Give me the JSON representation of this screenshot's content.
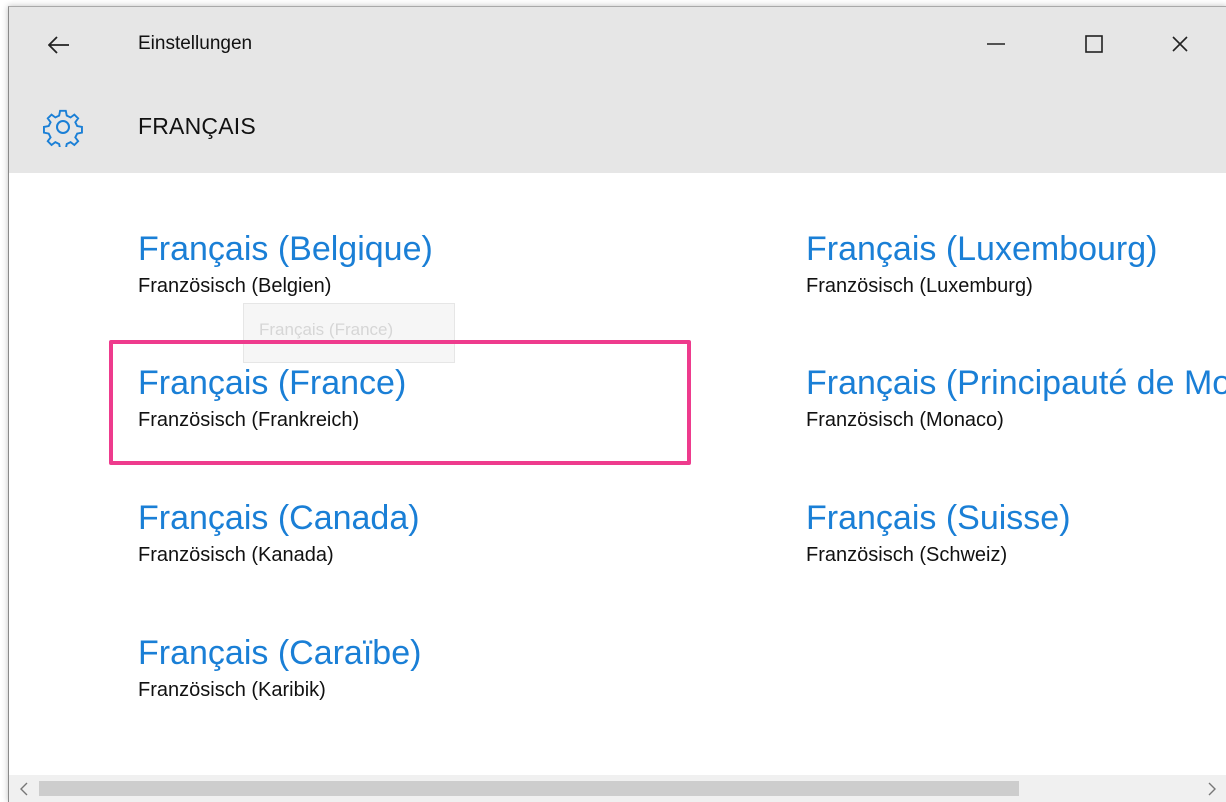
{
  "titlebar": {
    "title": "Einstellungen",
    "back_icon": "back-arrow-icon",
    "minimize_icon": "minimize-icon",
    "maximize_icon": "maximize-icon",
    "close_icon": "close-icon"
  },
  "page": {
    "title": "FRANÇAIS",
    "icon": "gear-icon"
  },
  "drag_ghost": {
    "label": "Français (France)"
  },
  "languages": [
    {
      "native": "Français (Belgique)",
      "german": "Französisch (Belgien)"
    },
    {
      "native": "Français (France)",
      "german": "Französisch (Frankreich)",
      "highlighted": true
    },
    {
      "native": "Français (Canada)",
      "german": "Französisch (Kanada)"
    },
    {
      "native": "Français (Caraïbe)",
      "german": "Französisch (Karibik)"
    },
    {
      "native": "Français (Luxembourg)",
      "german": "Französisch (Luxemburg)"
    },
    {
      "native": "Français (Principauté de Monaco)",
      "german": "Französisch (Monaco)"
    },
    {
      "native": "Français (Suisse)",
      "german": "Französisch (Schweiz)"
    }
  ],
  "colors": {
    "accent": "#1a7fd6",
    "highlight_border": "#ee3b8d",
    "header_background": "#e6e6e6"
  }
}
